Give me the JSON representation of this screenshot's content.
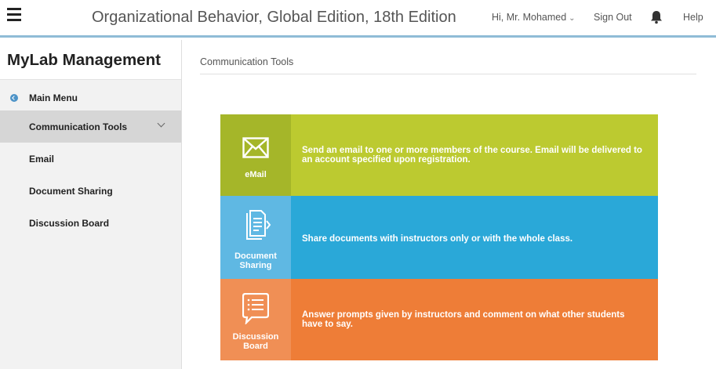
{
  "header": {
    "course_title": "Organizational Behavior, Global Edition, 18th Edition",
    "greeting": "Hi, Mr. Mohamed",
    "sign_out": "Sign Out",
    "help": "Help"
  },
  "sidebar": {
    "brand": "MyLab Management",
    "main_menu": "Main Menu",
    "items": [
      {
        "label": "Communication Tools",
        "active": true
      },
      {
        "label": "Email"
      },
      {
        "label": "Document Sharing"
      },
      {
        "label": "Discussion Board"
      }
    ]
  },
  "main": {
    "breadcrumb": "Communication Tools",
    "tiles": [
      {
        "icon": "envelope-icon",
        "label": "eMail",
        "description": "Send an email to one or more members of the course. Email will be delivered to an account specified upon registration.",
        "color": "#bcca30"
      },
      {
        "icon": "documents-icon",
        "label_line1": "Document",
        "label_line2": "Sharing",
        "description": "Share documents with instructors only or with the whole class.",
        "color": "#2aa8d8"
      },
      {
        "icon": "discussion-icon",
        "label_line1": "Discussion",
        "label_line2": "Board",
        "description": "Answer prompts given by instructors and comment on what other students have to say.",
        "color": "#ee7d37"
      }
    ]
  }
}
